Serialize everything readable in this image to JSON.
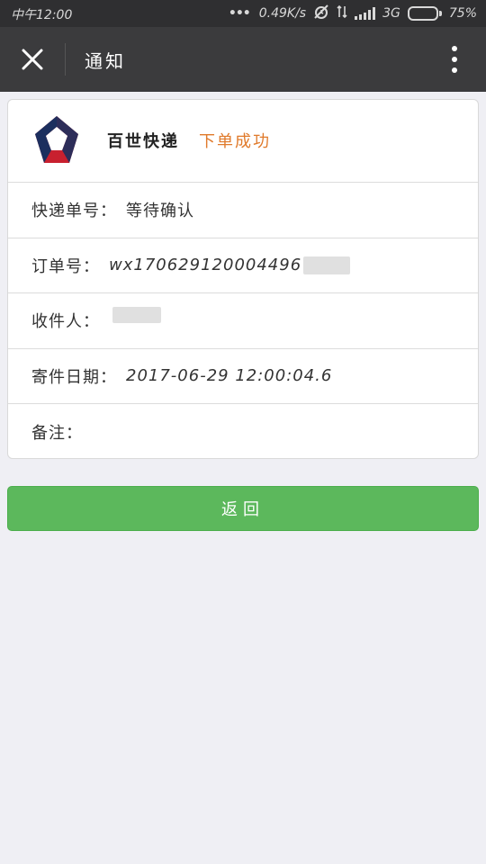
{
  "status_bar": {
    "time": "中午12:00",
    "network_speed": "0.49K/s",
    "network_type": "3G",
    "battery": "75%",
    "battery_level": 0.75
  },
  "navbar": {
    "title": "通知",
    "close_icon": "close-icon",
    "more_icon": "more-vertical-icon"
  },
  "card": {
    "company": "百世快递",
    "status": "下单成功",
    "status_color": "#e07a2b",
    "rows": [
      {
        "label": "快递单号：",
        "value": "等待确认"
      },
      {
        "label": "订单号：",
        "value": "wx170629120004496"
      },
      {
        "label": "收件人：",
        "value": ""
      },
      {
        "label": "寄件日期：",
        "value": "2017-06-29 12:00:04.6"
      },
      {
        "label": "备注：",
        "value": ""
      }
    ]
  },
  "button": {
    "label": "返回",
    "color": "#5cb85c"
  }
}
